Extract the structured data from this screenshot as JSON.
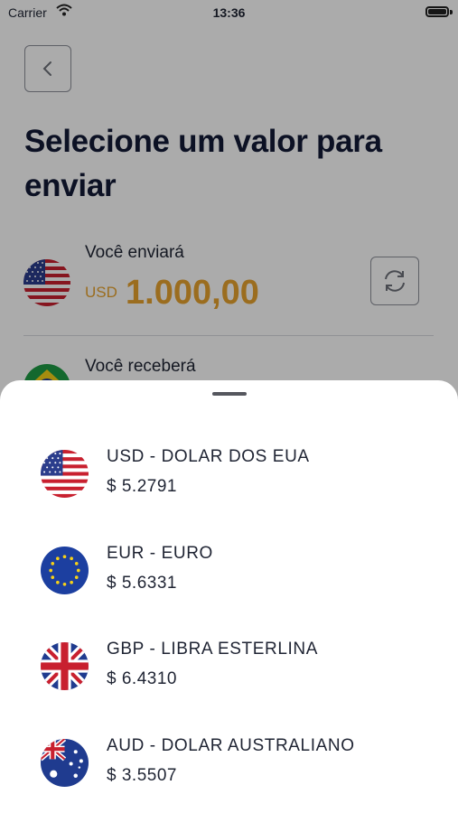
{
  "status_bar": {
    "carrier": "Carrier",
    "time": "13:36"
  },
  "page": {
    "title": "Selecione um valor para enviar",
    "send_label": "Você enviará",
    "send_currency": "USD",
    "send_amount": "1.000,00",
    "receive_label": "Você receberá"
  },
  "currency_sheet": {
    "items": [
      {
        "name": "USD - DOLAR DOS EUA",
        "rate": "$ 5.2791",
        "flag": "us-flag-icon"
      },
      {
        "name": "EUR - EURO",
        "rate": "$ 5.6331",
        "flag": "eu-flag-icon"
      },
      {
        "name": "GBP - LIBRA ESTERLINA",
        "rate": "$ 6.4310",
        "flag": "uk-flag-icon"
      },
      {
        "name": "AUD - DOLAR AUSTRALIANO",
        "rate": "$ 3.5507",
        "flag": "au-flag-icon"
      }
    ]
  },
  "colors": {
    "accent": "#e7a32f",
    "title": "#121a36",
    "text": "#1f2433",
    "overlay": "rgba(0,0,0,0.33)"
  }
}
